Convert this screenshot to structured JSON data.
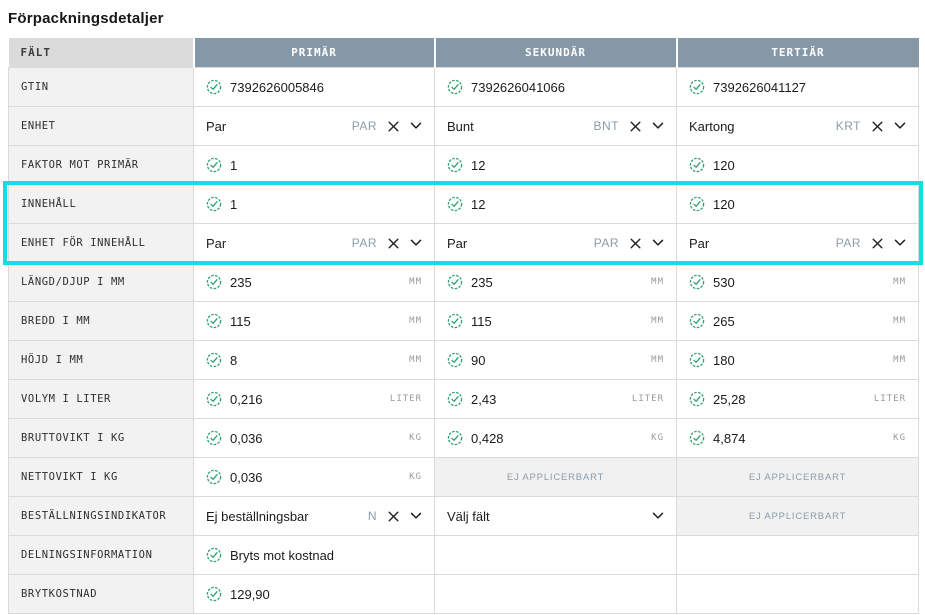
{
  "page": {
    "title": "Förpackningsdetaljer"
  },
  "icons": {
    "check_icon": "✓ (green dashed circle check)",
    "clear_icon": "✕",
    "chevron_down_icon": "⌄"
  },
  "colors": {
    "level_header_bg": "#8598A7",
    "field_header_bg": "#DBDBDB",
    "label_cell_bg": "#F2F2F2",
    "na_cell_bg": "#F1F1F1",
    "highlight_border": "#10E0E0",
    "check_green": "#2EA26B",
    "code_text": "#8B9CAB",
    "unit_text": "#9A9A9A",
    "grid_border": "#DADADA"
  },
  "table": {
    "columns": [
      "FÄLT",
      "PRIMÄR",
      "SEKUNDÄR",
      "TERTIÄR"
    ],
    "rows": [
      {
        "label": "GTIN",
        "cells": [
          {
            "type": "check",
            "value": "7392626005846"
          },
          {
            "type": "check",
            "value": "7392626041066"
          },
          {
            "type": "check",
            "value": "7392626041127"
          }
        ]
      },
      {
        "label": "ENHET",
        "cells": [
          {
            "type": "select",
            "value": "Par",
            "code": "PAR"
          },
          {
            "type": "select",
            "value": "Bunt",
            "code": "BNT"
          },
          {
            "type": "select",
            "value": "Kartong",
            "code": "KRT"
          }
        ]
      },
      {
        "label": "FAKTOR MOT PRIMÄR",
        "cells": [
          {
            "type": "check",
            "value": "1"
          },
          {
            "type": "check",
            "value": "12"
          },
          {
            "type": "check",
            "value": "120"
          }
        ]
      },
      {
        "label": "INNEHÅLL",
        "highlight": true,
        "cells": [
          {
            "type": "check",
            "value": "1"
          },
          {
            "type": "check",
            "value": "12"
          },
          {
            "type": "check",
            "value": "120"
          }
        ]
      },
      {
        "label": "ENHET FÖR INNEHÅLL",
        "highlight": true,
        "cells": [
          {
            "type": "select",
            "value": "Par",
            "code": "PAR"
          },
          {
            "type": "select",
            "value": "Par",
            "code": "PAR"
          },
          {
            "type": "select",
            "value": "Par",
            "code": "PAR"
          }
        ]
      },
      {
        "label": "LÄNGD/DJUP I MM",
        "cells": [
          {
            "type": "check",
            "value": "235",
            "unit": "MM"
          },
          {
            "type": "check",
            "value": "235",
            "unit": "MM"
          },
          {
            "type": "check",
            "value": "530",
            "unit": "MM"
          }
        ]
      },
      {
        "label": "BREDD I MM",
        "cells": [
          {
            "type": "check",
            "value": "115",
            "unit": "MM"
          },
          {
            "type": "check",
            "value": "115",
            "unit": "MM"
          },
          {
            "type": "check",
            "value": "265",
            "unit": "MM"
          }
        ]
      },
      {
        "label": "HÖJD I MM",
        "cells": [
          {
            "type": "check",
            "value": "8",
            "unit": "MM"
          },
          {
            "type": "check",
            "value": "90",
            "unit": "MM"
          },
          {
            "type": "check",
            "value": "180",
            "unit": "MM"
          }
        ]
      },
      {
        "label": "VOLYM I LITER",
        "cells": [
          {
            "type": "check",
            "value": "0,216",
            "unit": "LITER"
          },
          {
            "type": "check",
            "value": "2,43",
            "unit": "LITER"
          },
          {
            "type": "check",
            "value": "25,28",
            "unit": "LITER"
          }
        ]
      },
      {
        "label": "BRUTTOVIKT I KG",
        "cells": [
          {
            "type": "check",
            "value": "0,036",
            "unit": "KG"
          },
          {
            "type": "check",
            "value": "0,428",
            "unit": "KG"
          },
          {
            "type": "check",
            "value": "4,874",
            "unit": "KG"
          }
        ]
      },
      {
        "label": "NETTOVIKT I KG",
        "cells": [
          {
            "type": "check",
            "value": "0,036",
            "unit": "KG"
          },
          {
            "type": "na",
            "text": "EJ APPLICERBART"
          },
          {
            "type": "na",
            "text": "EJ APPLICERBART"
          }
        ]
      },
      {
        "label": "BESTÄLLNINGSINDIKATOR",
        "cells": [
          {
            "type": "select",
            "value": "Ej beställningsbar",
            "code": "N"
          },
          {
            "type": "select_placeholder",
            "value": "Välj fält"
          },
          {
            "type": "na",
            "text": "EJ APPLICERBART"
          }
        ]
      },
      {
        "label": "DELNINGSINFORMATION",
        "cells": [
          {
            "type": "check",
            "value": "Bryts mot kostnad"
          },
          {
            "type": "empty"
          },
          {
            "type": "empty"
          }
        ]
      },
      {
        "label": "BRYTKOSTNAD",
        "cells": [
          {
            "type": "check",
            "value": "129,90"
          },
          {
            "type": "empty"
          },
          {
            "type": "empty"
          }
        ]
      }
    ]
  }
}
